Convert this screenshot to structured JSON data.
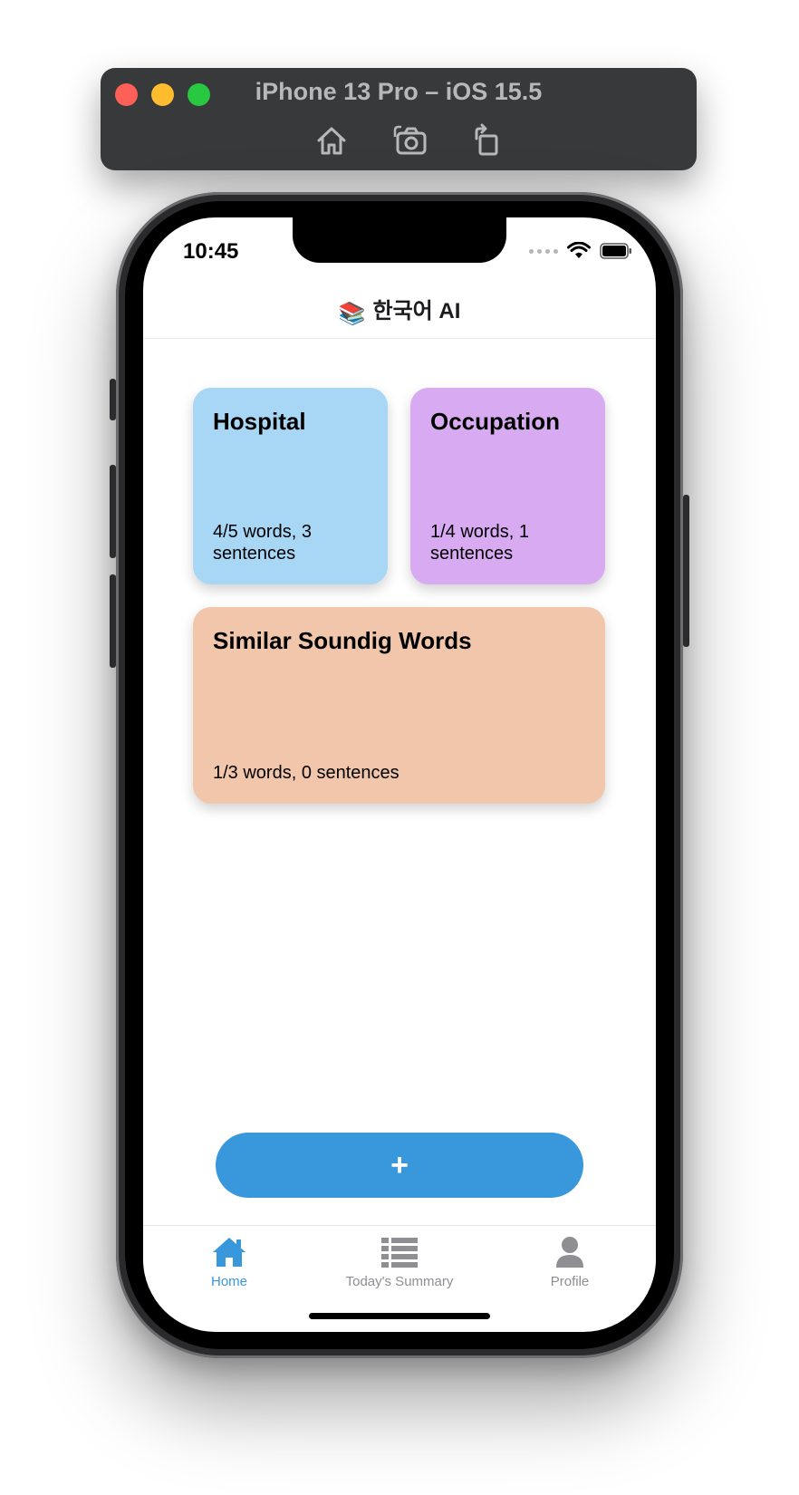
{
  "simulator": {
    "title": "iPhone 13 Pro – iOS 15.5",
    "tools": [
      "home-icon",
      "screenshot-icon",
      "rotate-icon"
    ]
  },
  "status_bar": {
    "time": "10:45"
  },
  "header": {
    "emoji": "📚",
    "title": "한국어 AI"
  },
  "cards": [
    {
      "title": "Hospital",
      "meta": "4/5 words, 3 sentences",
      "color": "#a8d6f5"
    },
    {
      "title": "Occupation",
      "meta": "1/4 words, 1 sentences",
      "color": "#d7aaf2"
    },
    {
      "title": "Similar Soundig Words",
      "meta": "1/3 words, 0 sentences",
      "color": "#f2c6aa"
    }
  ],
  "add_button": {
    "label": "+"
  },
  "tabs": [
    {
      "label": "Home",
      "icon": "home-icon",
      "active": true
    },
    {
      "label": "Today's Summary",
      "icon": "list-icon",
      "active": false
    },
    {
      "label": "Profile",
      "icon": "profile-icon",
      "active": false
    }
  ],
  "colors": {
    "accent": "#3997db",
    "inactive": "#8e8e93"
  }
}
